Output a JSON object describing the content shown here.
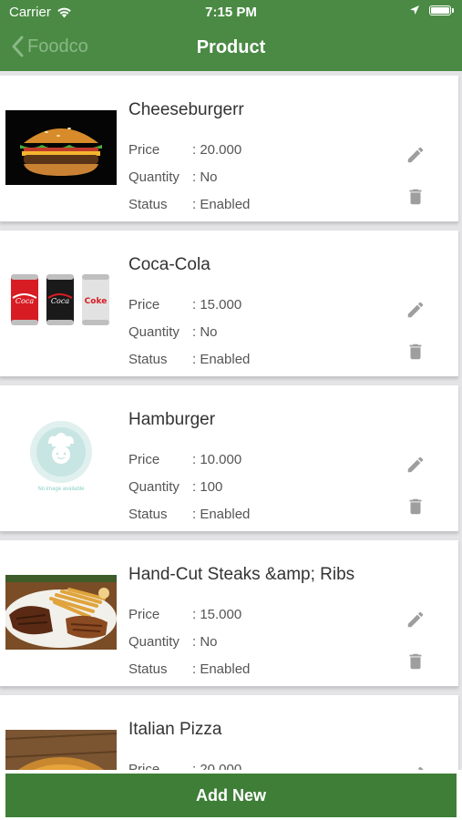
{
  "status_bar": {
    "carrier": "Carrier",
    "time": "7:15 PM"
  },
  "nav": {
    "back_label": "Foodco",
    "title": "Product"
  },
  "products": [
    {
      "name": "Cheeseburgerr",
      "price_label": "Price",
      "price": ": 20.000",
      "quantity_label": "Quantity",
      "quantity": ": No",
      "status_label": "Status",
      "status": ": Enabled",
      "image": "cheeseburger-photo"
    },
    {
      "name": "Coca-Cola",
      "price_label": "Price",
      "price": ": 15.000",
      "quantity_label": "Quantity",
      "quantity": ": No",
      "status_label": "Status",
      "status": ": Enabled",
      "image": "coca-cola-cans-photo"
    },
    {
      "name": "Hamburger",
      "price_label": "Price",
      "price": ": 10.000",
      "quantity_label": "Quantity",
      "quantity": ": 100",
      "status_label": "Status",
      "status": ": Enabled",
      "image": "no-image-placeholder",
      "placeholder_text": "No image available"
    },
    {
      "name": "Hand-Cut Steaks &amp; Ribs",
      "price_label": "Price",
      "price": ": 15.000",
      "quantity_label": "Quantity",
      "quantity": ": No",
      "status_label": "Status",
      "status": ": Enabled",
      "image": "steaks-ribs-photo"
    },
    {
      "name": "Italian Pizza",
      "price_label": "Price",
      "price": ": 20.000",
      "image": "pizza-photo"
    }
  ],
  "footer": {
    "add_label": "Add New"
  },
  "colors": {
    "header": "#4a8a44",
    "button": "#3e7e37",
    "icon": "#9e9e9e"
  }
}
